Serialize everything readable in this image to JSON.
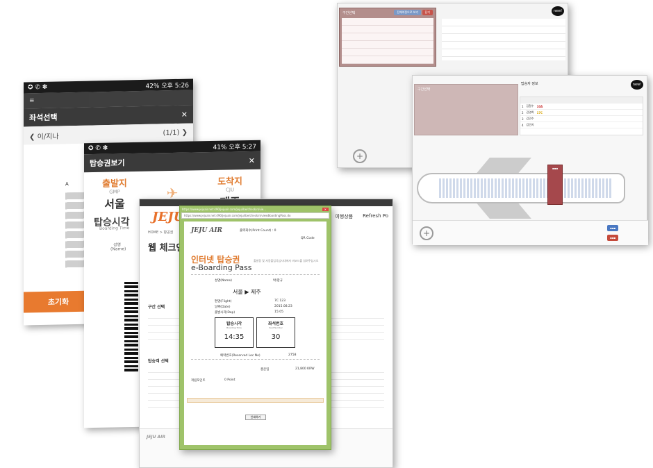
{
  "back_window": {
    "popup_title": "구간선택",
    "btn_label": "전체여정으로 보기",
    "btn_close": "닫기",
    "new_badge": "new!"
  },
  "front_window": {
    "popup_title": "구간선택",
    "info_title": "탑승자 정보",
    "new_badge": "new!",
    "rows": [
      {
        "no": "1",
        "name": "김철수",
        "seat": "10A"
      },
      {
        "no": "2",
        "name": "김영희",
        "seat": "17C"
      },
      {
        "no": "3",
        "name": "김민수",
        "seat": ""
      },
      {
        "no": "4",
        "name": "김민지",
        "seat": ""
      }
    ],
    "zoom_icon": "zoom-in-icon"
  },
  "phone1": {
    "status_time": "오후 5:26",
    "status_battery": "42%",
    "title": "좌석선택",
    "prev": "이/지나",
    "page": "(1/1)",
    "seat_letters": "A B",
    "reset_button": "초기화"
  },
  "phone2": {
    "status_time": "오후 5:27",
    "status_battery": "41%",
    "title": "탑승권보기",
    "dep_label": "출발지",
    "dep_code": "GMP",
    "dep_city": "서울",
    "arr_label": "도착지",
    "arr_code": "CJU",
    "arr_city": "제주",
    "boarding_label": "탑승시각",
    "boarding_sub": "Boarding Time",
    "name_label": "성명",
    "name_sub": "(Name)"
  },
  "web": {
    "logo": "JEJU",
    "nav": [
      "여행상품",
      "Refresh Po"
    ],
    "crumb": "HOME > 항공권",
    "title": "웹 체크인",
    "section1": "구간 선택",
    "section2": "탑승객 선택",
    "foot_logo": "JEJU AIR"
  },
  "pass": {
    "window_title": "https://www.jejuair.net:490/jejuair.com/jeju/ibe/checkin/vie...",
    "url": "https://www.jejuair.net:490/jejuair.com/jeju/ibe/checkin/viewBoardingPass.do",
    "logo": "JEJU AIR",
    "reservation": "출력회수(Print Count) : 0",
    "qr_label": "QR Code",
    "heading_ko": "인터넷 탑승권",
    "heading_en": "e-Boarding Pass",
    "note": "출발장 및 자동출입국심사대에서 바코드를 읽혀주십시오",
    "name_label": "성명(Name)",
    "name_value": "박/창규",
    "route": "서울 ▶ 제주",
    "flight_label": "편명(Flight)",
    "flight_value": "7C 123",
    "date_label": "날짜(Date)",
    "date_value": "2015.08.23",
    "dep_label": "출발시각(Dep)",
    "dep_value": "15:05",
    "boarding_title": "탑승시각",
    "boarding_sub": "Boarding Time",
    "boarding_value": "14:35",
    "seat_title": "좌석번호",
    "seat_sub": "Seat Number",
    "seat_value": "30",
    "resv_label": "예약번호(Reserved Loc No)",
    "resv_value": "2758",
    "fare_label": "총운임",
    "fare_value": "21,800 KRW",
    "point_label": "적립포인트",
    "point_value": "0 Point",
    "print_button": "인쇄하기"
  }
}
